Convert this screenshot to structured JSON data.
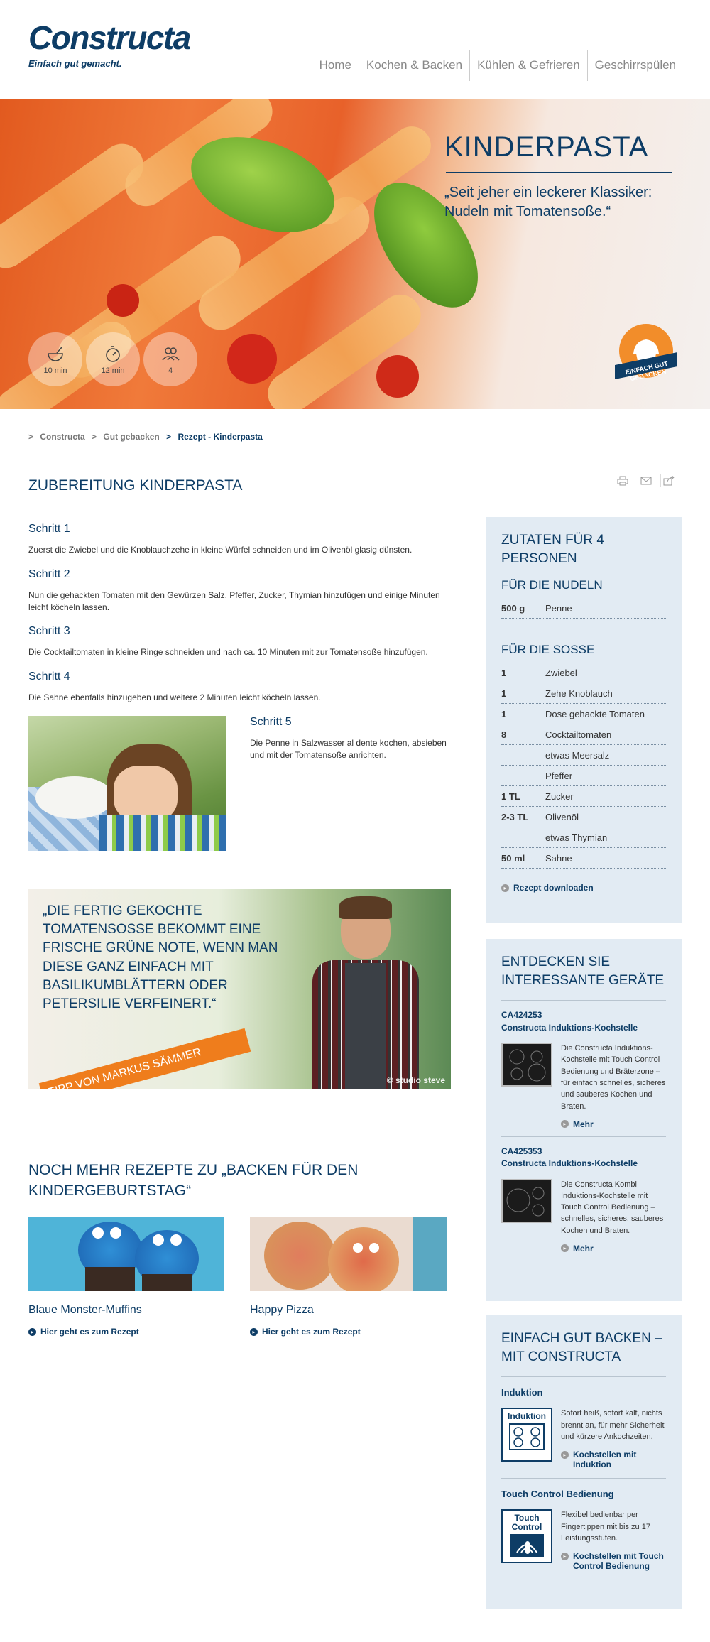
{
  "header": {
    "logo": "Constructa",
    "tagline": "Einfach gut gemacht.",
    "nav": [
      "Home",
      "Kochen & Backen",
      "Kühlen & Gefrieren",
      "Geschirrspülen"
    ]
  },
  "hero": {
    "title": "KINDERPASTA",
    "quote": "„Seit jeher ein leckerer Klassiker: Nudeln mit Tomatensoße.“",
    "info": [
      {
        "icon": "bowl-icon",
        "label": "10 min"
      },
      {
        "icon": "stopwatch-icon",
        "label": "12 min"
      },
      {
        "icon": "people-icon",
        "label": "4"
      }
    ],
    "badge": "EINFACH GUT GEBACKEN"
  },
  "breadcrumb": {
    "items": [
      "Constructa",
      "Gut gebacken",
      "Rezept - Kinderpasta"
    ],
    "separator": ">"
  },
  "main": {
    "title": "ZUBEREITUNG KINDERPASTA",
    "steps": [
      {
        "title": "Schritt 1",
        "text": "Zuerst die Zwiebel und die Knoblauchzehe in kleine Würfel schneiden und im Olivenöl glasig dünsten."
      },
      {
        "title": "Schritt 2",
        "text": "Nun die gehackten Tomaten mit den Gewürzen Salz, Pfeffer, Zucker, Thymian hinzufügen und einige Minuten leicht köcheln lassen."
      },
      {
        "title": "Schritt 3",
        "text": "Die Cocktailtomaten in kleine Ringe schneiden und nach ca. 10 Minuten mit zur Tomatensoße hinzufügen."
      },
      {
        "title": "Schritt 4",
        "text": "Die Sahne ebenfalls hinzugeben und weitere 2 Minuten leicht köcheln lassen."
      },
      {
        "title": "Schritt 5",
        "text": "Die Penne in Salzwasser al dente kochen, absieben und mit der Tomatensoße anrichten."
      }
    ],
    "tip": {
      "quote": "„DIE FERTIG GEKOCHTE TOMATENSOSSE BEKOMMT EINE FRISCHE GRÜNE NOTE, WENN MAN DIESE GANZ EINFACH MIT BASILIKUMBLÄTTERN ODER PETERSILIE VERFEINERT.“",
      "banner": "TIPP VON MARKUS SÄMMER",
      "credit": "© studio steve"
    },
    "more": {
      "title": "NOCH MEHR REZEPTE ZU „BACKEN FÜR DEN KINDERGEBURTSTAG“",
      "cards": [
        {
          "title": "Blaue Monster-Muffins",
          "link": "Hier geht es zum Rezept"
        },
        {
          "title": "Happy Pizza",
          "link": "Hier geht es zum Rezept"
        }
      ]
    }
  },
  "sidebar": {
    "ingredients": {
      "title": "ZUTATEN FÜR 4 PERSONEN",
      "noodles_title": "FÜR DIE NUDELN",
      "noodles": [
        {
          "qty": "500 g",
          "name": "Penne"
        }
      ],
      "sauce_title": "FÜR DIE SOSSE",
      "sauce": [
        {
          "qty": "1",
          "name": "Zwiebel"
        },
        {
          "qty": "1",
          "name": "Zehe Knoblauch"
        },
        {
          "qty": "1",
          "name": "Dose gehackte Tomaten"
        },
        {
          "qty": "8",
          "name": "Cocktailtomaten"
        },
        {
          "qty": "",
          "name": "etwas Meersalz"
        },
        {
          "qty": "",
          "name": "Pfeffer"
        },
        {
          "qty": "1 TL",
          "name": "Zucker"
        },
        {
          "qty": "2-3 TL",
          "name": "Olivenöl"
        },
        {
          "qty": "",
          "name": "etwas Thymian"
        },
        {
          "qty": "50 ml",
          "name": "Sahne"
        }
      ],
      "download": "Rezept downloaden"
    },
    "devices": {
      "title": "ENTDECKEN SIE INTERESSANTE GERÄTE",
      "items": [
        {
          "code": "CA424253",
          "name": "Constructa Induktions-Kochstelle",
          "desc": "Die Constructa Induktions-Kochstelle mit Touch Control Bedienung und Bräterzone – für einfach schnelles, sicheres und sauberes Kochen und Braten.",
          "link": "Mehr"
        },
        {
          "code": "CA425353",
          "name": "Constructa Induktions-Kochstelle",
          "desc": "Die Constructa Kombi Induktions-Kochstelle mit Touch Control Bedienung – schnelles, sicheres, sauberes Kochen und Braten.",
          "link": "Mehr"
        }
      ]
    },
    "features": {
      "title": "EINFACH GUT BACKEN – MIT CONSTRUCTA",
      "items": [
        {
          "title": "Induktion",
          "icon_label": "Induktion",
          "desc": "Sofort heiß, sofort kalt, nichts brennt an, für mehr Sicherheit und kürzere Ankochzeiten.",
          "link": "Kochstellen mit Induktion"
        },
        {
          "title": "Touch Control Bedienung",
          "icon_label": "Touch Control",
          "desc": "Flexibel bedienbar per Fingertippen mit bis zu 17 Leistungsstufen.",
          "link": "Kochstellen mit Touch Control Bedienung"
        }
      ]
    }
  },
  "colors": {
    "brand": "#0e3d66",
    "accent": "#ef7d1c",
    "sidebar_bg": "#e2ebf3"
  }
}
